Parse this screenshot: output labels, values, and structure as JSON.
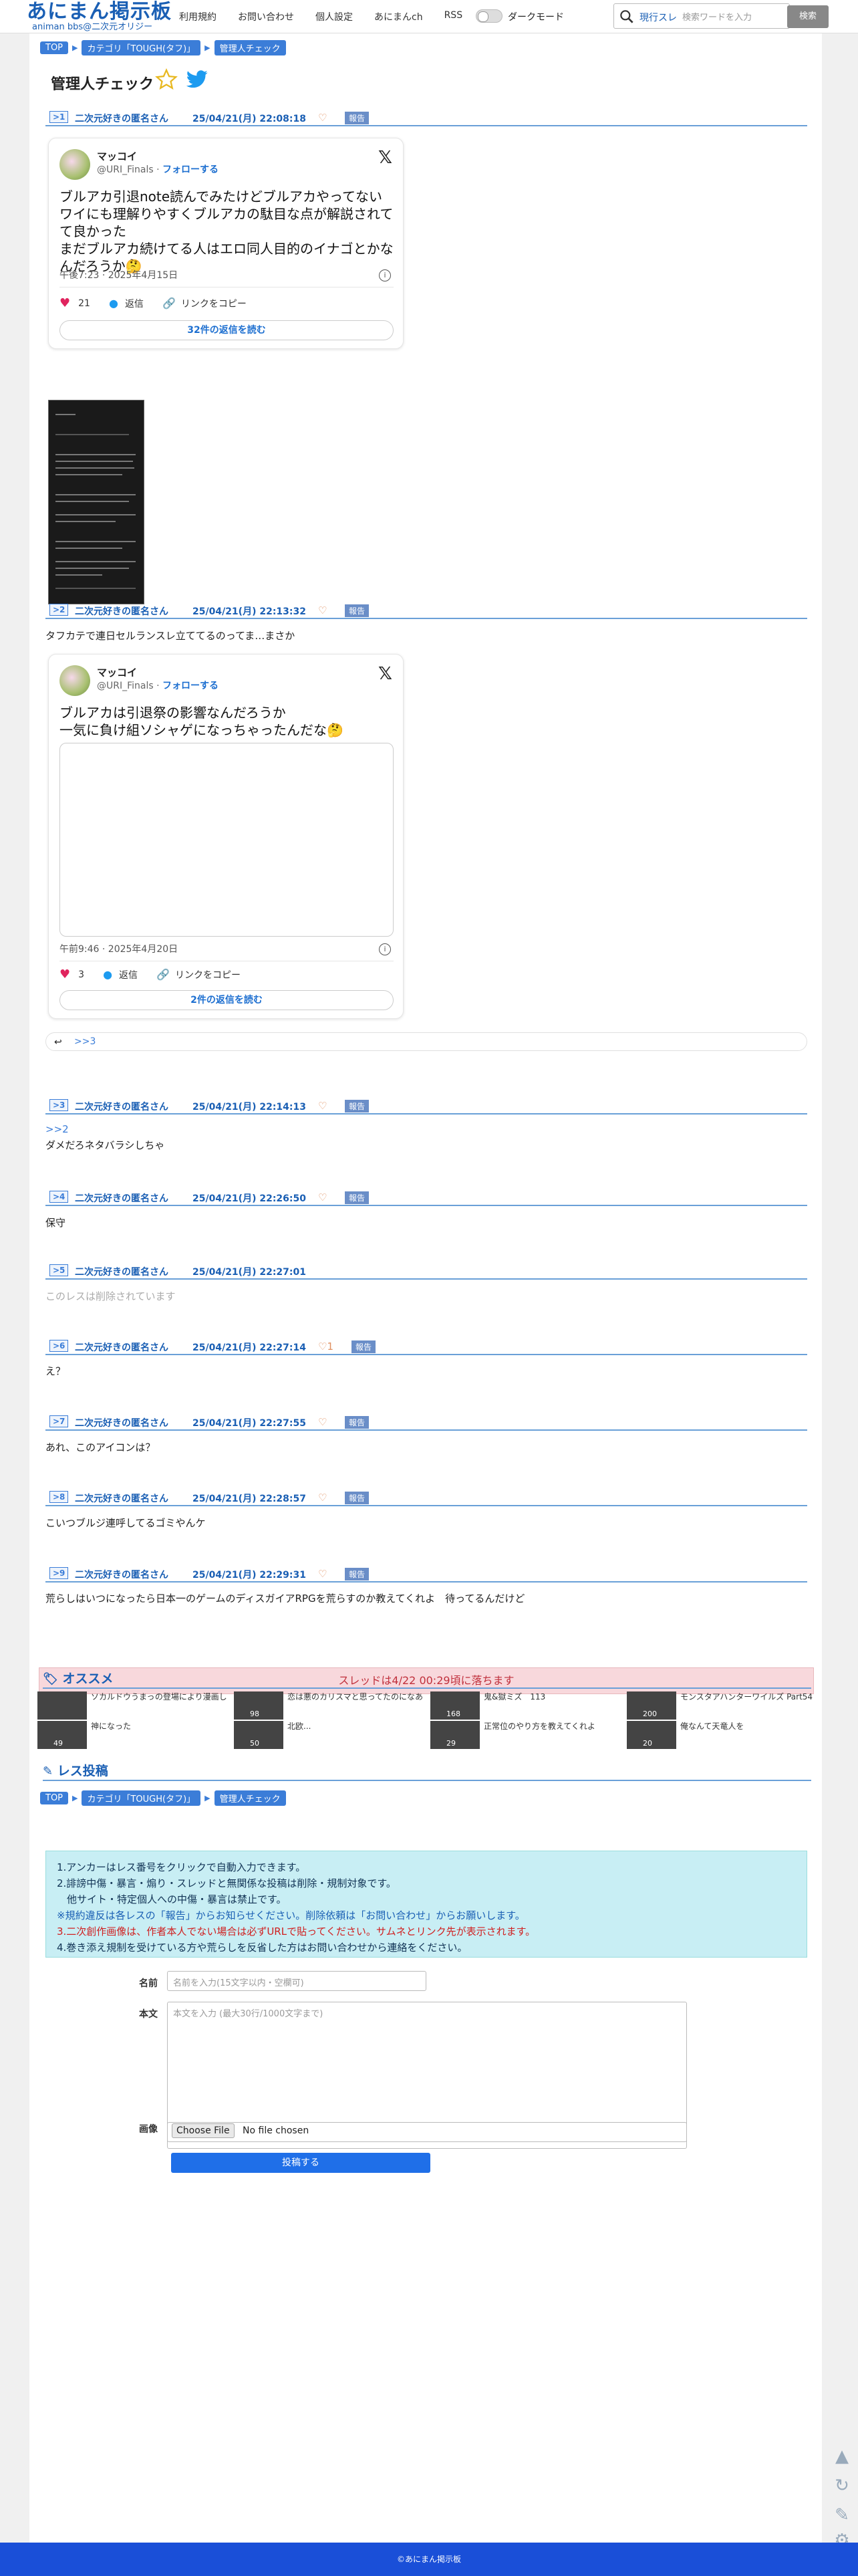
{
  "header": {
    "logo_title": "あにまん掲示板",
    "logo_subtitle": "animan bbs@二次元オリジー",
    "nav": [
      "利用規約",
      "お問い合わせ",
      "個人設定",
      "あにまんch",
      "RSS"
    ],
    "dark_mode_label": "ダークモード",
    "search_scope": "現行スレ",
    "search_placeholder": "検索ワードを入力",
    "search_button": "検索"
  },
  "breadcrumb": {
    "top": "TOP",
    "category": "カテゴリ「TOUGH(タフ)」",
    "current": "管理人チェック"
  },
  "thread_title": "管理人チェック",
  "posts": [
    {
      "num": ">1",
      "name": "二次元好きの匿名さん",
      "date": "25/04/21(月) 22:08:18",
      "heart": "♡",
      "report": "報告"
    },
    {
      "num": ">2",
      "name": "二次元好きの匿名さん",
      "date": "25/04/21(月) 22:13:32",
      "heart": "♡",
      "report": "報告",
      "body": "タフカテで連日セルランスレ立ててるのってま…まさか"
    },
    {
      "num": ">3",
      "name": "二次元好きの匿名さん",
      "date": "25/04/21(月) 22:14:13",
      "heart": "♡",
      "report": "報告",
      "anchor": ">>2",
      "body": "ダメだろネタバラシしちゃ"
    },
    {
      "num": ">4",
      "name": "二次元好きの匿名さん",
      "date": "25/04/21(月) 22:26:50",
      "heart": "♡",
      "report": "報告",
      "body": "保守"
    },
    {
      "num": ">5",
      "name": "二次元好きの匿名さん",
      "date": "25/04/21(月) 22:27:01",
      "body": "このレスは削除されています"
    },
    {
      "num": ">6",
      "name": "二次元好きの匿名さん",
      "date": "25/04/21(月) 22:27:14",
      "heart": "♡1",
      "report": "報告",
      "body": "え？"
    },
    {
      "num": ">7",
      "name": "二次元好きの匿名さん",
      "date": "25/04/21(月) 22:27:55",
      "heart": "♡",
      "report": "報告",
      "body": "あれ、このアイコンは？"
    },
    {
      "num": ">8",
      "name": "二次元好きの匿名さん",
      "date": "25/04/21(月) 22:28:57",
      "heart": "♡",
      "report": "報告",
      "body": "こいつブルジ連呼してるゴミやんケ"
    },
    {
      "num": ">9",
      "name": "二次元好きの匿名さん",
      "date": "25/04/21(月) 22:29:31",
      "heart": "♡",
      "report": "報告",
      "body": "荒らしはいつになったら日本一のゲームのディスガイアRPGを荒らすのか教えてくれよ　待ってるんだけど"
    }
  ],
  "tweet1": {
    "user": "マッコイ",
    "handle": "@URI_Finals",
    "follow": "フォローする",
    "text": "ブルアカ引退note読んでみたけどブルアカやってないワイにも理解りやすくブルアカの駄目な点が解説されてて良かった\nまだブルアカ続けてる人はエロ同人目的のイナゴとかなんだろうか🤔",
    "time": "午後7:23 · 2025年4月15日",
    "likes": "21",
    "reply": "返信",
    "copy": "リンクをコピー",
    "more": "32件の返信を読む"
  },
  "tweet2": {
    "user": "マッコイ",
    "handle": "@URI_Finals",
    "follow": "フォローする",
    "text": "ブルアカは引退祭の影響なんだろうか\n一気に負け組ソシャゲになっちゃったんだな🤔",
    "time": "午前9:46 · 2025年4月20日",
    "likes": "3",
    "reply": "返信",
    "copy": "リンクをコピー",
    "more": "2件の返信を読む"
  },
  "reply_to_3": ">>3",
  "warning": "スレッドは4/22 00:29頃に落ちます",
  "recommend": {
    "title": "オススメ",
    "items": [
      {
        "text": "ソカルドウうまっの登場により漫画し",
        "badge": ""
      },
      {
        "text": "恋は悪のカリスマと思ってたのになあ",
        "badge": "98"
      },
      {
        "text": "鬼&獄ミズ　113",
        "badge": "168"
      },
      {
        "text": "モンスタアハンターワイルズ Part54",
        "badge": "200"
      },
      {
        "text": "神になった",
        "badge": "49"
      },
      {
        "text": "北欧...",
        "badge": "50"
      },
      {
        "text": "正常位のやり方を教えてくれよ",
        "badge": "29"
      },
      {
        "text": "俺なんて天竜人を",
        "badge": "20"
      }
    ]
  },
  "form": {
    "title": "レス投稿",
    "rules": [
      "1.アンカーはレス番号をクリックで自動入力できます。",
      "2.誹謗中傷・暴言・煽り・スレッドと無関係な投稿は削除・規制対象です。",
      "　他サイト・特定個人への中傷・暴言は禁止です。",
      "※規約違反は各レスの「報告」からお知らせください。削除依頼は「お問い合わせ」からお願いします。",
      "3.二次創作画像は、作者本人でない場合は必ずURLで貼ってください。サムネとリンク先が表示されます。",
      "4.巻き添え規制を受けている方や荒らしを反省した方はお問い合わせから連絡をください。"
    ],
    "name_label": "名前",
    "name_placeholder": "名前を入力(15文字以内・空欄可)",
    "body_label": "本文",
    "body_placeholder": "本文を入力 (最大30行/1000文字まで)",
    "image_label": "画像",
    "file_button": "Choose File",
    "file_status": "No file chosen",
    "submit": "投稿する"
  },
  "footer": "©あにまん掲示板",
  "colors": {
    "accent": "#1a5fb4",
    "button": "#1f6fe8",
    "footer": "#1a4fd8",
    "warning_bg": "#f8d8dc"
  }
}
